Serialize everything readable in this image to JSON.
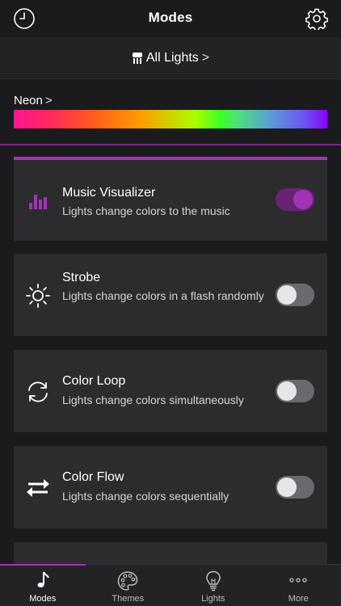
{
  "header": {
    "title": "Modes"
  },
  "lights_bar": {
    "label": "All Lights",
    "chevron": ">"
  },
  "theme": {
    "name": "Neon",
    "chevron": ">"
  },
  "modes": [
    {
      "id": "music-visualizer",
      "title": "Music Visualizer",
      "description": "Lights change colors to the music",
      "enabled": true,
      "icon": "equalizer-bars-icon"
    },
    {
      "id": "strobe",
      "title": "Strobe",
      "description": "Lights change colors in a flash randomly",
      "enabled": false,
      "icon": "sun-icon"
    },
    {
      "id": "color-loop",
      "title": "Color Loop",
      "description": "Lights change colors simultaneously",
      "enabled": false,
      "icon": "loop-arrows-icon"
    },
    {
      "id": "color-flow",
      "title": "Color Flow",
      "description": "Lights change colors sequentially",
      "enabled": false,
      "icon": "swap-arrows-icon"
    }
  ],
  "tabs": [
    {
      "label": "Modes",
      "icon": "music-note-icon",
      "selected": true
    },
    {
      "label": "Themes",
      "icon": "palette-icon",
      "selected": false
    },
    {
      "label": "Lights",
      "icon": "lightbulb-icon",
      "selected": false
    },
    {
      "label": "More",
      "icon": "more-dots-icon",
      "selected": false
    }
  ],
  "colors": {
    "accent": "#a134b6",
    "card": "#2c2c2f",
    "background": "#1b1b1d"
  }
}
